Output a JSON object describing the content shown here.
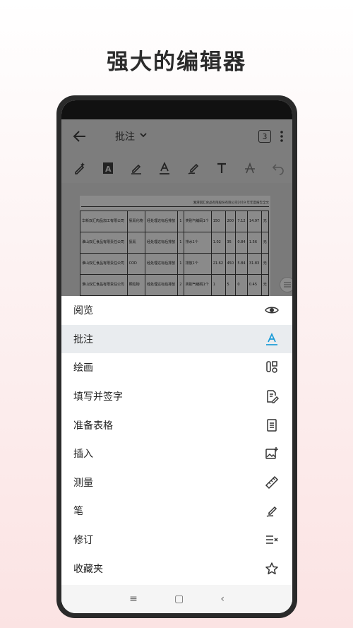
{
  "headline": "强大的编辑器",
  "appbar": {
    "title": "批注",
    "page_count": "3"
  },
  "document": {
    "header_text": "湘潭回汇食品有限股份有限公司2019 年年度报告全文",
    "rows": [
      [
        "华新双汇肉品加工有限公司",
        "氨氮化物",
        "经处理达标后排放",
        "1",
        "类别气编码1个",
        "150",
        "200",
        "7.12",
        "14.97",
        "无"
      ],
      [
        "淮山双汇食品有限责任公司",
        "氨氮",
        "经处理达标后排放",
        "1",
        "排水1个",
        "1.02",
        "35",
        "0.84",
        "1.56",
        "无"
      ],
      [
        "淮山双汇食品有限责任公司",
        "COD",
        "经处理达标后排放",
        "1",
        "排放1个",
        "21.62",
        "450",
        "5.84",
        "31.83",
        "无"
      ],
      [
        "淮山双汇食品有限责任公司",
        "颗粒物",
        "经处理达标后排放",
        "2",
        "类别气编码1个",
        "1",
        "5",
        "0",
        "0.45",
        "无"
      ]
    ]
  },
  "menu": {
    "items": [
      {
        "label": "阅览",
        "icon": "eye-icon"
      },
      {
        "label": "批注",
        "icon": "text-annotate-icon",
        "active": true
      },
      {
        "label": "绘画",
        "icon": "draw-icon"
      },
      {
        "label": "填写并签字",
        "icon": "fill-sign-icon"
      },
      {
        "label": "准备表格",
        "icon": "form-icon"
      },
      {
        "label": "插入",
        "icon": "insert-image-icon"
      },
      {
        "label": "测量",
        "icon": "ruler-icon"
      },
      {
        "label": "笔",
        "icon": "pen-icon"
      },
      {
        "label": "修订",
        "icon": "redact-icon"
      },
      {
        "label": "收藏夹",
        "icon": "star-icon"
      }
    ]
  },
  "navbar": {
    "menu_glyph": "≡",
    "home_glyph": "▢",
    "back_glyph": "‹"
  },
  "colors": {
    "accent": "#1a9bd7",
    "appbar_overlay": "#7d7d7d",
    "active_row": "#e9ecef"
  }
}
